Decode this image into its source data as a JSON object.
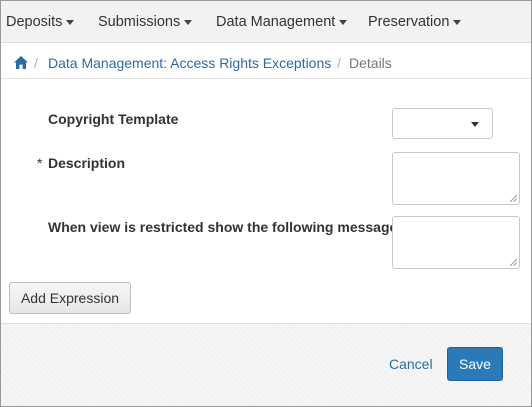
{
  "nav": {
    "items": [
      {
        "label": "Deposits"
      },
      {
        "label": "Submissions"
      },
      {
        "label": "Data Management"
      },
      {
        "label": "Preservation"
      }
    ]
  },
  "breadcrumb": {
    "home_icon": "home-icon",
    "link_label": "Data Management: Access Rights Exceptions",
    "separator": "/",
    "current_label": "Details"
  },
  "form": {
    "copyright_template": {
      "label": "Copyright Template",
      "value": ""
    },
    "description": {
      "required_mark": "*",
      "label": "Description",
      "value": ""
    },
    "restricted_message": {
      "label": "When view is restricted show the following message",
      "value": ""
    },
    "add_expression_label": "Add Expression"
  },
  "footer": {
    "cancel_label": "Cancel",
    "save_label": "Save"
  },
  "colors": {
    "link": "#2c6aa6",
    "primary_button": "#2a7ab9",
    "nav_background": "#f2f2f2"
  }
}
